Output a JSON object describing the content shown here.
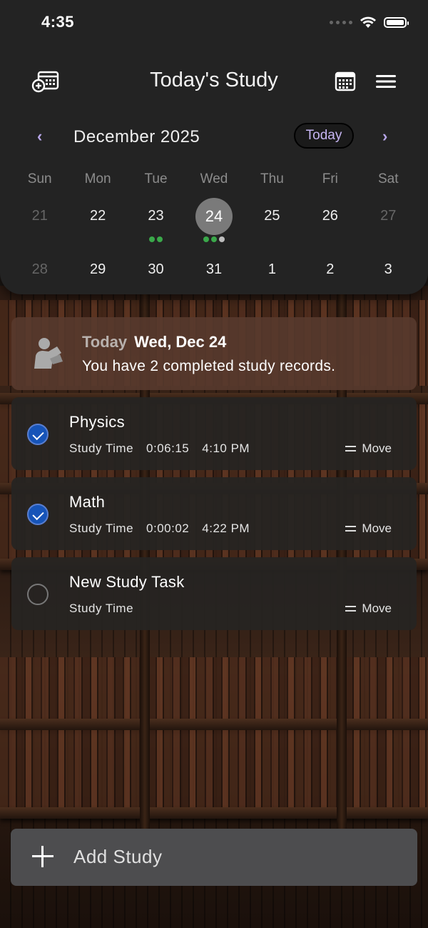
{
  "status_bar": {
    "time": "4:35"
  },
  "header": {
    "title": "Today's Study"
  },
  "calendar": {
    "month_label": "December 2025",
    "today_button": "Today",
    "weekdays": [
      "Sun",
      "Mon",
      "Tue",
      "Wed",
      "Thu",
      "Fri",
      "Sat"
    ],
    "week1": [
      "21",
      "22",
      "23",
      "24",
      "25",
      "26",
      "27"
    ],
    "week2": [
      "28",
      "29",
      "30",
      "31",
      "1",
      "2",
      "3"
    ],
    "selected_day": "24",
    "colors": {
      "accent": "#c6b5f2",
      "mark_green": "#3aa84a",
      "mark_gray": "#bdbdbd",
      "selected": "#7a7a7a"
    }
  },
  "summary": {
    "today_label": "Today",
    "date_label": "Wed, Dec 24",
    "message": "You have 2 completed study records."
  },
  "tasks": [
    {
      "name": "Physics",
      "time_label": "Study Time",
      "duration": "0:06:15",
      "clock": "4:10 PM",
      "move_label": "Move",
      "done": true
    },
    {
      "name": "Math",
      "time_label": "Study Time",
      "duration": "0:00:02",
      "clock": "4:22 PM",
      "move_label": "Move",
      "done": true
    },
    {
      "name": "New Study Task",
      "time_label": "Study Time",
      "duration": "",
      "clock": "",
      "move_label": "Move",
      "done": false
    }
  ],
  "add_button": {
    "label": "Add Study"
  },
  "icons": {
    "left_header": "calendar-add-icon",
    "right_header_1": "calendar-grid-icon",
    "right_header_2": "menu-icon"
  }
}
